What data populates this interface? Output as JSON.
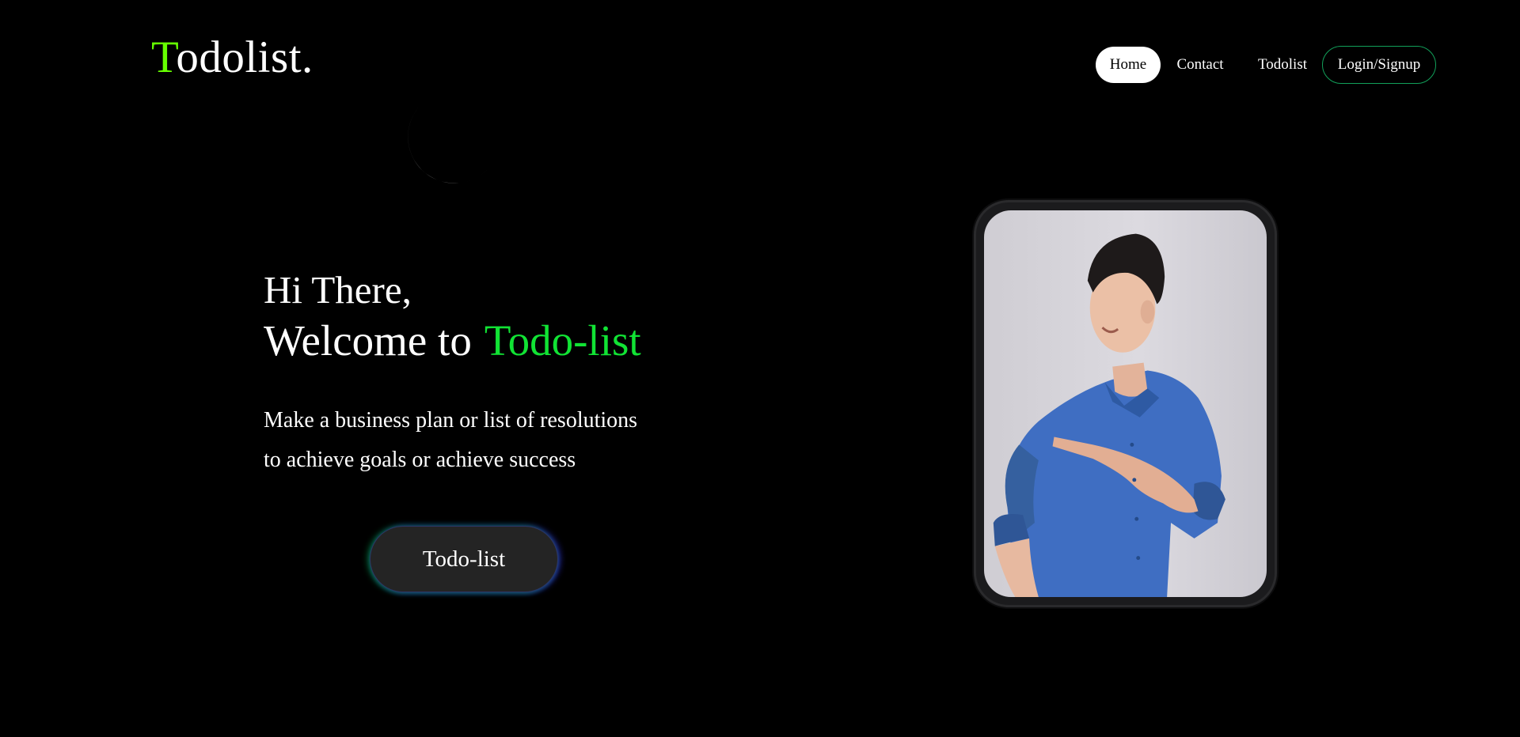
{
  "logo": {
    "first_letter": "T",
    "rest": "odolist."
  },
  "nav": {
    "home": "Home",
    "contact": "Contact",
    "todolist": "Todolist",
    "login": "Login/Signup"
  },
  "hero": {
    "greeting": "Hi There,",
    "welcome_prefix": "Welcome to",
    "welcome_brand": "Todo-list",
    "description_line1": "Make a business plan or list of resolutions",
    "description_line2": "to achieve goals or achieve success",
    "cta_label": "Todo-list"
  },
  "icons": {
    "theme_toggle": "moon-icon"
  },
  "colors": {
    "background": "#000000",
    "logo_accent": "#66ff00",
    "brand_green": "#11e334",
    "login_border": "#12a05a",
    "cta_background": "#242424"
  }
}
